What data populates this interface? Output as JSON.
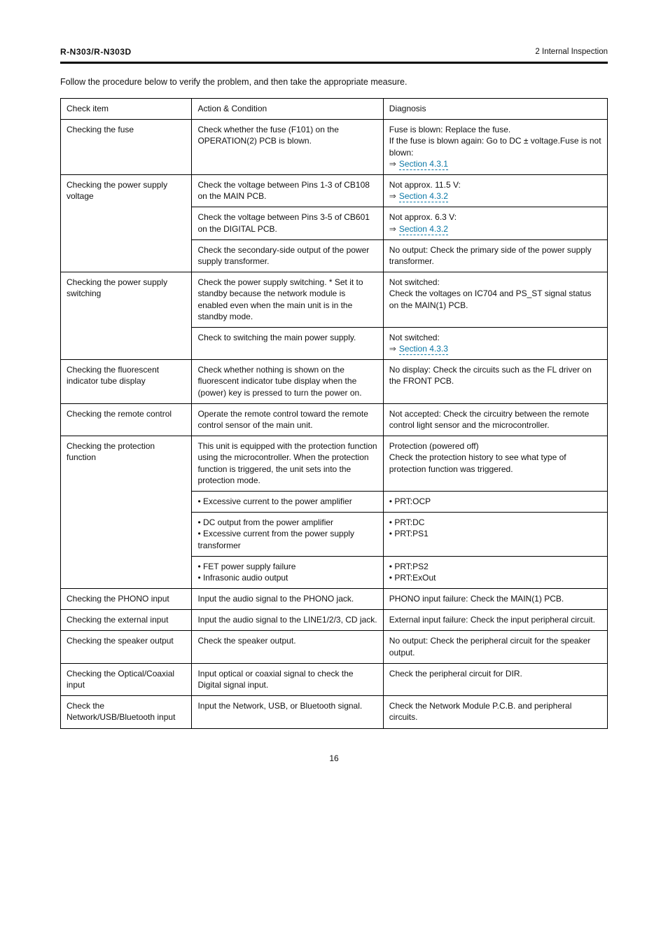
{
  "header": {
    "model": "R-N303/R-N303D",
    "section": "2 Internal Inspection"
  },
  "intro": "Follow the procedure below to verify the problem, and then take the appropriate measure.",
  "cols": [
    "Check item",
    "Action & Condition",
    "Diagnosis"
  ],
  "rows": [
    {
      "c1": "Checking the fuse",
      "c2": "Check whether the fuse (F101) on the OPERATION(2) PCB is blown.",
      "c3_parts": [
        {
          "t": "Fuse is blown: Replace the fuse.\nIf the fuse is blown again: Go to DC ± voltage."
        },
        {
          "t": "Fuse is not blown:\n"
        },
        {
          "arrow": true,
          "link": "Section 4.3.1"
        }
      ]
    },
    {
      "c1": "Checking the power supply voltage",
      "sub": [
        {
          "c2": "Check the voltage between Pins 1-3 of CB108 on the MAIN PCB.",
          "c3_parts": [
            {
              "t": "Not approx. 11.5 V:\n"
            },
            {
              "arrow": true,
              "link": "Section 4.3.2"
            }
          ]
        },
        {
          "c2": "Check the voltage between Pins 3-5 of CB601 on the DIGITAL PCB.",
          "c3_parts": [
            {
              "t": "Not approx. 6.3 V:\n"
            },
            {
              "arrow": true,
              "link": "Section 4.3.2"
            }
          ]
        },
        {
          "c2": "Check the secondary-side output of the power supply transformer.",
          "c3_parts": [
            {
              "t": "No output: Check the primary side of the power supply transformer."
            }
          ]
        }
      ]
    },
    {
      "c1": "Checking the power supply switching",
      "sub": [
        {
          "c2": "Check the power supply switching.    * Set it to standby because the network module is enabled even when the main unit is in the standby mode.",
          "c3_parts": [
            {
              "t": "Not switched:\nCheck the voltages on IC704 and PS_ST signal status on the MAIN(1) PCB."
            }
          ]
        },
        {
          "c2": "Check to switching the main power supply.",
          "c3_parts": [
            {
              "t": "Not switched:\n"
            },
            {
              "arrow": true,
              "link": "Section 4.3.3"
            }
          ]
        }
      ]
    },
    {
      "c1": "Checking the fluorescent indicator tube display",
      "c2": "Check whether nothing is shown on the fluorescent indicator tube display when the (power) key is pressed to turn the power on.",
      "c3_parts": [
        {
          "t": "No display: Check the circuits such as the FL driver on the FRONT PCB."
        }
      ]
    },
    {
      "c1": "Checking the remote control",
      "c2": "Operate the remote control toward the remote control sensor of the main unit.",
      "c3_parts": [
        {
          "t": "Not accepted: Check the circuitry between the remote control light sensor and the microcontroller."
        }
      ]
    },
    {
      "c1": "Checking the protection function",
      "rowspan": 4,
      "sub": [
        {
          "c2": "This unit is equipped with the protection function using the microcontroller. When the protection function is triggered, the unit sets into the protection mode.",
          "c3_parts": [
            {
              "t": "Protection (powered off)\nCheck the protection history to see what type of protection function was triggered."
            }
          ]
        },
        {
          "c2": "• Excessive current to the power amplifier",
          "c3_parts": [
            {
              "t": "• PRT:OCP"
            }
          ]
        },
        {
          "c2": "• DC output from the power amplifier\n• Excessive current from the power supply transformer",
          "c3_parts": [
            {
              "t": "• PRT:DC\n• PRT:PS1"
            }
          ]
        },
        {
          "c2": "• FET power supply failure\n• Infrasonic audio output",
          "c3_parts": [
            {
              "t": "• PRT:PS2\n• PRT:ExOut"
            }
          ]
        }
      ]
    },
    {
      "c1": "Checking the PHONO input",
      "c2": "Input the audio signal to the PHONO jack.",
      "c3_parts": [
        {
          "t": "PHONO input failure: Check the MAIN(1) PCB."
        }
      ]
    },
    {
      "c1": "Checking the external input",
      "c2": "Input the audio signal to the LINE1/2/3, CD jack.",
      "c3_parts": [
        {
          "t": "External input failure: Check the input peripheral circuit."
        }
      ]
    },
    {
      "c1": "Checking the speaker output",
      "c2": "Check the speaker output.",
      "c3_parts": [
        {
          "t": "No output: Check the peripheral circuit for the speaker output."
        }
      ]
    },
    {
      "c1": "Checking the Optical/Coaxial input",
      "c2": "Input optical or coaxial signal to check the Digital signal input.",
      "c3_parts": [
        {
          "t": "Check the peripheral circuit for DIR."
        }
      ]
    },
    {
      "c1": "Check the Network/USB/Bluetooth input",
      "c2": "Input the Network, USB, or Bluetooth signal.",
      "c3_parts": [
        {
          "t": "Check the Network Module P.C.B. and peripheral circuits."
        }
      ]
    }
  ],
  "page": "16"
}
